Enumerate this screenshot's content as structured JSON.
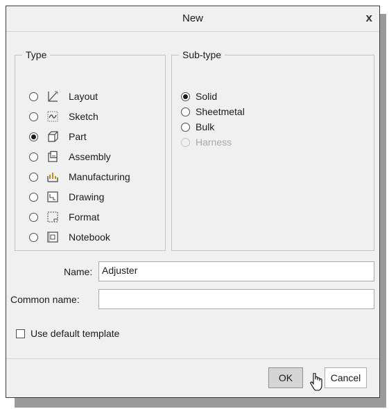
{
  "dialog": {
    "title": "New",
    "close_label": "x"
  },
  "type_group": {
    "label": "Type",
    "items": [
      {
        "label": "Layout",
        "icon": "layout-icon",
        "selected": false
      },
      {
        "label": "Sketch",
        "icon": "sketch-icon",
        "selected": false
      },
      {
        "label": "Part",
        "icon": "part-icon",
        "selected": true
      },
      {
        "label": "Assembly",
        "icon": "assembly-icon",
        "selected": false
      },
      {
        "label": "Manufacturing",
        "icon": "manufacturing-icon",
        "selected": false
      },
      {
        "label": "Drawing",
        "icon": "drawing-icon",
        "selected": false
      },
      {
        "label": "Format",
        "icon": "format-icon",
        "selected": false
      },
      {
        "label": "Notebook",
        "icon": "notebook-icon",
        "selected": false
      }
    ]
  },
  "subtype_group": {
    "label": "Sub-type",
    "items": [
      {
        "label": "Solid",
        "selected": true,
        "enabled": true
      },
      {
        "label": "Sheetmetal",
        "selected": false,
        "enabled": true
      },
      {
        "label": "Bulk",
        "selected": false,
        "enabled": true
      },
      {
        "label": "Harness",
        "selected": false,
        "enabled": false
      }
    ]
  },
  "fields": {
    "name_label": "Name:",
    "name_value": "Adjuster",
    "common_name_label": "Common name:",
    "common_name_value": ""
  },
  "options": {
    "use_default_template_label": "Use default template",
    "use_default_template_checked": false
  },
  "buttons": {
    "ok": "OK",
    "cancel": "Cancel"
  }
}
